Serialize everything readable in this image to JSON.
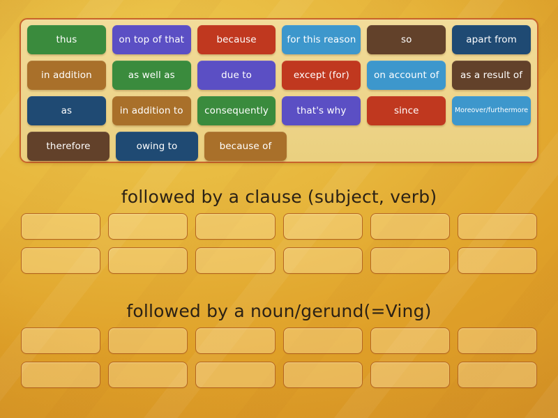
{
  "activity": {
    "type": "group-sort",
    "background_color": "#e2a42e"
  },
  "word_bank": {
    "panel_fill": "#eed58c",
    "panel_border": "#c8622c",
    "rows": [
      [
        {
          "label": "thus",
          "color": "#3a8b3d"
        },
        {
          "label": "on top of that",
          "color": "#5b4fc4"
        },
        {
          "label": "because",
          "color": "#c0381f"
        },
        {
          "label": "for this reason",
          "color": "#3d97cc"
        },
        {
          "label": "so",
          "color": "#62412a"
        },
        {
          "label": "apart from",
          "color": "#1f4a73"
        }
      ],
      [
        {
          "label": "in addition",
          "color": "#a9702a"
        },
        {
          "label": "as well as",
          "color": "#3a8b3d"
        },
        {
          "label": "due to",
          "color": "#5b4fc4"
        },
        {
          "label": "except (for)",
          "color": "#c0381f"
        },
        {
          "label": "on account of",
          "color": "#3d97cc"
        },
        {
          "label": "as a result of",
          "color": "#62412a"
        }
      ],
      [
        {
          "label": "as",
          "color": "#1f4a73"
        },
        {
          "label": "in addition to",
          "color": "#a9702a"
        },
        {
          "label": "consequently",
          "color": "#3a8b3d"
        },
        {
          "label": "that's why",
          "color": "#5b4fc4"
        },
        {
          "label": "since",
          "color": "#c0381f"
        },
        {
          "label": "Moreover/furthermore",
          "color": "#3d97cc",
          "small": true
        }
      ],
      [
        {
          "label": "therefore",
          "color": "#62412a"
        },
        {
          "label": "owing to",
          "color": "#1f4a73"
        },
        {
          "label": "because of",
          "color": "#a9702a"
        }
      ]
    ]
  },
  "categories": [
    {
      "title": "followed by a clause (subject, verb)",
      "rows": [
        6,
        6
      ]
    },
    {
      "title": "followed by a noun/gerund(=Ving)",
      "rows": [
        6,
        6
      ]
    }
  ]
}
